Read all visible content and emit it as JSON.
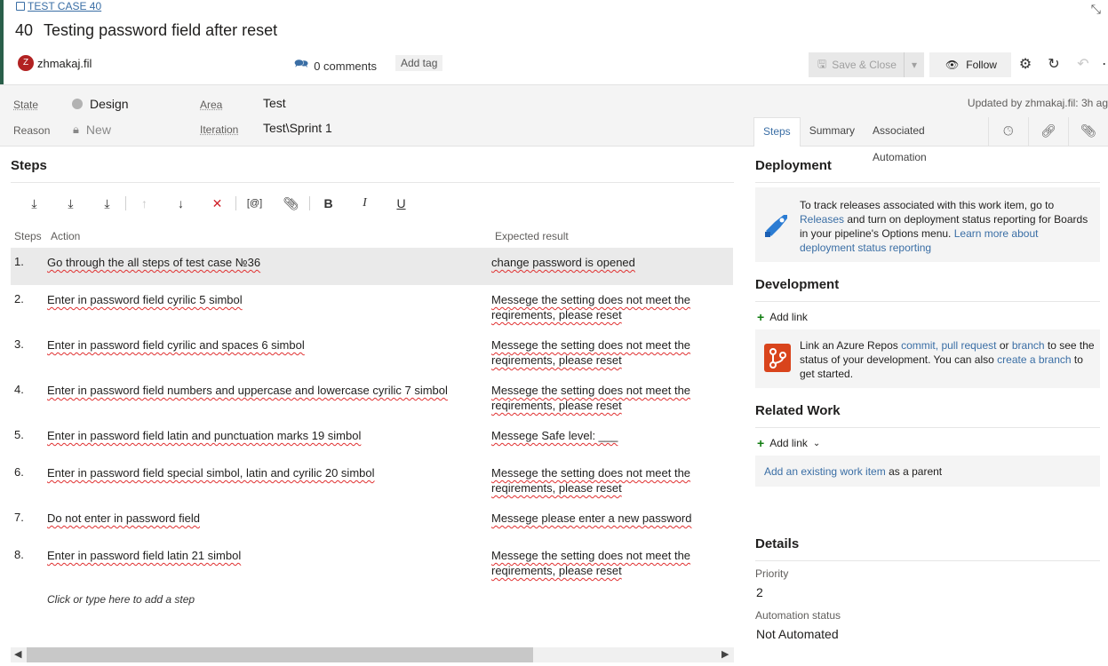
{
  "header": {
    "case_link": "TEST CASE 40",
    "id": "40",
    "title": "Testing password field after reset",
    "user_initial": "Z",
    "user_name": "zhmakaj.fil",
    "comments": "0 comments",
    "add_tag": "Add tag",
    "save_close": "Save & Close",
    "follow": "Follow"
  },
  "fields": {
    "state_label": "State",
    "state_value": "Design",
    "reason_label": "Reason",
    "reason_value": "New",
    "area_label": "Area",
    "area_value": "Test",
    "iteration_label": "Iteration",
    "iteration_value": "Test\\Sprint 1",
    "updated": "Updated by zhmakaj.fil: 3h ag"
  },
  "tabs": [
    "Steps",
    "Summary",
    "Associated Automation"
  ],
  "steps": {
    "title": "Steps",
    "col_steps": "Steps",
    "col_action": "Action",
    "col_expected": "Expected result",
    "rows": [
      {
        "num": "1.",
        "action": "Go through the all steps of test case №36",
        "expected": "change password is opened"
      },
      {
        "num": "2.",
        "action": "Enter in password field cyrilic 5 simbol",
        "expected": "Messege the setting does not meet the reqirements, please reset"
      },
      {
        "num": "3.",
        "action": "Enter in password field cyrilic and spaces 6 simbol",
        "expected": "Messege the setting does not meet the reqirements, please reset"
      },
      {
        "num": "4.",
        "action": "Enter in password field numbers and uppercase and lowercase cyrilic 7 simbol",
        "expected": "Messege the setting does not meet the reqirements, please reset"
      },
      {
        "num": "5.",
        "action": "Enter in password field latin and punctuation marks 19 simbol",
        "expected": "Messege Safe level: ___"
      },
      {
        "num": "6.",
        "action": "Enter in password field special simbol, latin and cyrilic 20 simbol",
        "expected": "Messege the setting does not meet the reqirements, please reset"
      },
      {
        "num": "7.",
        "action": "Do not enter in password field",
        "expected": "Messege please enter a new password"
      },
      {
        "num": "8.",
        "action": "Enter in password field latin 21 simbol",
        "expected": "Messege the setting does not meet the reqirements, please reset"
      }
    ],
    "add_step": "Click or type here to add a step"
  },
  "deployment": {
    "title": "Deployment",
    "text_1": "To track releases associated with this work item, go to",
    "link_releases": "Releases",
    "text_2": "and turn on deployment status reporting for Boards in your pipeline's Options menu.",
    "link_learn": "Learn more about deployment status reporting"
  },
  "development": {
    "title": "Development",
    "add_link": "Add link",
    "text_1": "Link an Azure Repos",
    "link_commit": "commit,",
    "link_pr": "pull request",
    "text_or": "or",
    "link_branch": "branch",
    "text_2": "to see the status of your development. You can also",
    "link_create": "create a branch",
    "text_3": "to get started."
  },
  "related_work": {
    "title": "Related Work",
    "add_link": "Add link",
    "link_existing": "Add an existing work item",
    "text_parent": "as a parent"
  },
  "details": {
    "title": "Details",
    "priority_label": "Priority",
    "priority_value": "2",
    "automation_label": "Automation status",
    "automation_value": "Not Automated"
  },
  "colors": {
    "accent": "#3a6ea5",
    "avatar": "#b22222",
    "delete": "#d0222a",
    "add": "#107c10"
  }
}
